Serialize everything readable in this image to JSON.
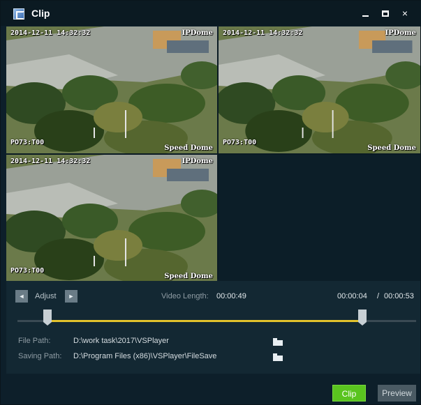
{
  "window": {
    "title": "Clip",
    "controls": {
      "minimize": "minimize",
      "maximize": "maximize",
      "close": "×"
    }
  },
  "video_cells": [
    {
      "timestamp": "2014-12-11 14:32:32",
      "brand": "IPDome",
      "camera": "PO73:T00",
      "speed": "Speed Dome"
    },
    {
      "timestamp": "2014-12-11 14:32:32",
      "brand": "IPDome",
      "camera": "PO73:T00",
      "speed": "Speed Dome"
    },
    {
      "timestamp": "2014-12-11 14:32:32",
      "brand": "IPDome",
      "camera": "PO73:T00",
      "speed": "Speed Dome"
    }
  ],
  "adjust": {
    "prev_glyph": "◄",
    "label": "Adjust",
    "next_glyph": "►"
  },
  "video_length": {
    "label": "Video Length:",
    "value": "00:00:49"
  },
  "time": {
    "current": "00:00:04",
    "separator": "/",
    "total": "00:00:53"
  },
  "slider": {
    "start_fraction": 0.075,
    "end_fraction": 0.865
  },
  "paths": {
    "file_path_label": "File Path:",
    "file_path_value": "D:\\work task\\2017\\VSPlayer",
    "saving_path_label": "Saving Path:",
    "saving_path_value": "D:\\Program Files (x86)\\VSPlayer\\FileSave"
  },
  "buttons": {
    "clip": "Clip",
    "preview": "Preview"
  },
  "colors": {
    "accent_green": "#5ac41f",
    "selection_yellow": "#e2c22c",
    "background": "#0d1f2a"
  }
}
